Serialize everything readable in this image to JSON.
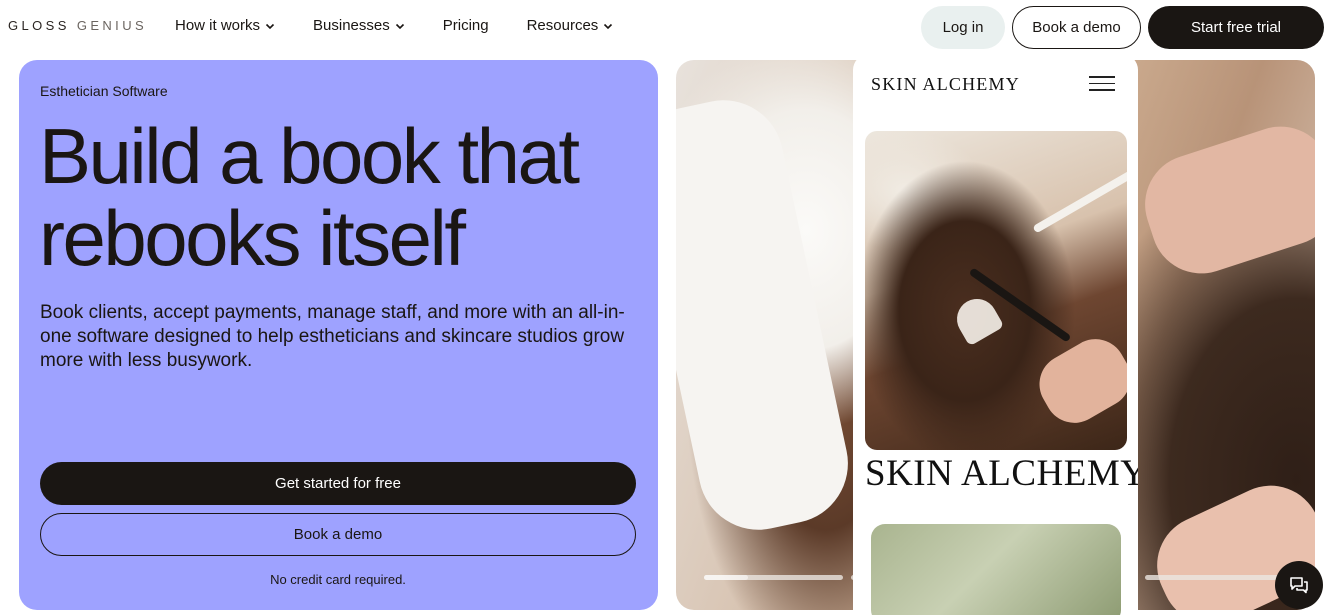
{
  "nav": {
    "logo_part1": "GLOSS",
    "logo_part2": "GENIUS",
    "menu": [
      {
        "label": "How it works",
        "has_dropdown": true
      },
      {
        "label": "Businesses",
        "has_dropdown": true
      },
      {
        "label": "Pricing",
        "has_dropdown": false
      },
      {
        "label": "Resources",
        "has_dropdown": true
      }
    ],
    "login_label": "Log in",
    "demo_label": "Book a demo",
    "trial_label": "Start free trial"
  },
  "hero": {
    "eyebrow": "Esthetician Software",
    "headline_line1": "Build a book that",
    "headline_line2": "rebooks itself",
    "subtext": "Book clients, accept payments, manage staff, and more with an all-in-one software designed to help estheticians and skincare studios grow more with less busywork.",
    "primary_cta": "Get started for free",
    "secondary_cta": "Book a demo",
    "note": "No credit card required."
  },
  "showcase": {
    "phone_brand": "SKIN ALCHEMY",
    "phone_big_brand": "SKIN ALCHEMY",
    "carousel_slides": 4,
    "active_slide": 1,
    "active_slide_progress": 0.32
  },
  "colors": {
    "hero_background": "#9ea2ff",
    "primary_dark": "#1a1613",
    "login_background": "#e9f0ef"
  },
  "icons": {
    "chevron": "chevron-down-icon",
    "menu": "hamburger-menu-icon",
    "chat": "chat-icon"
  }
}
